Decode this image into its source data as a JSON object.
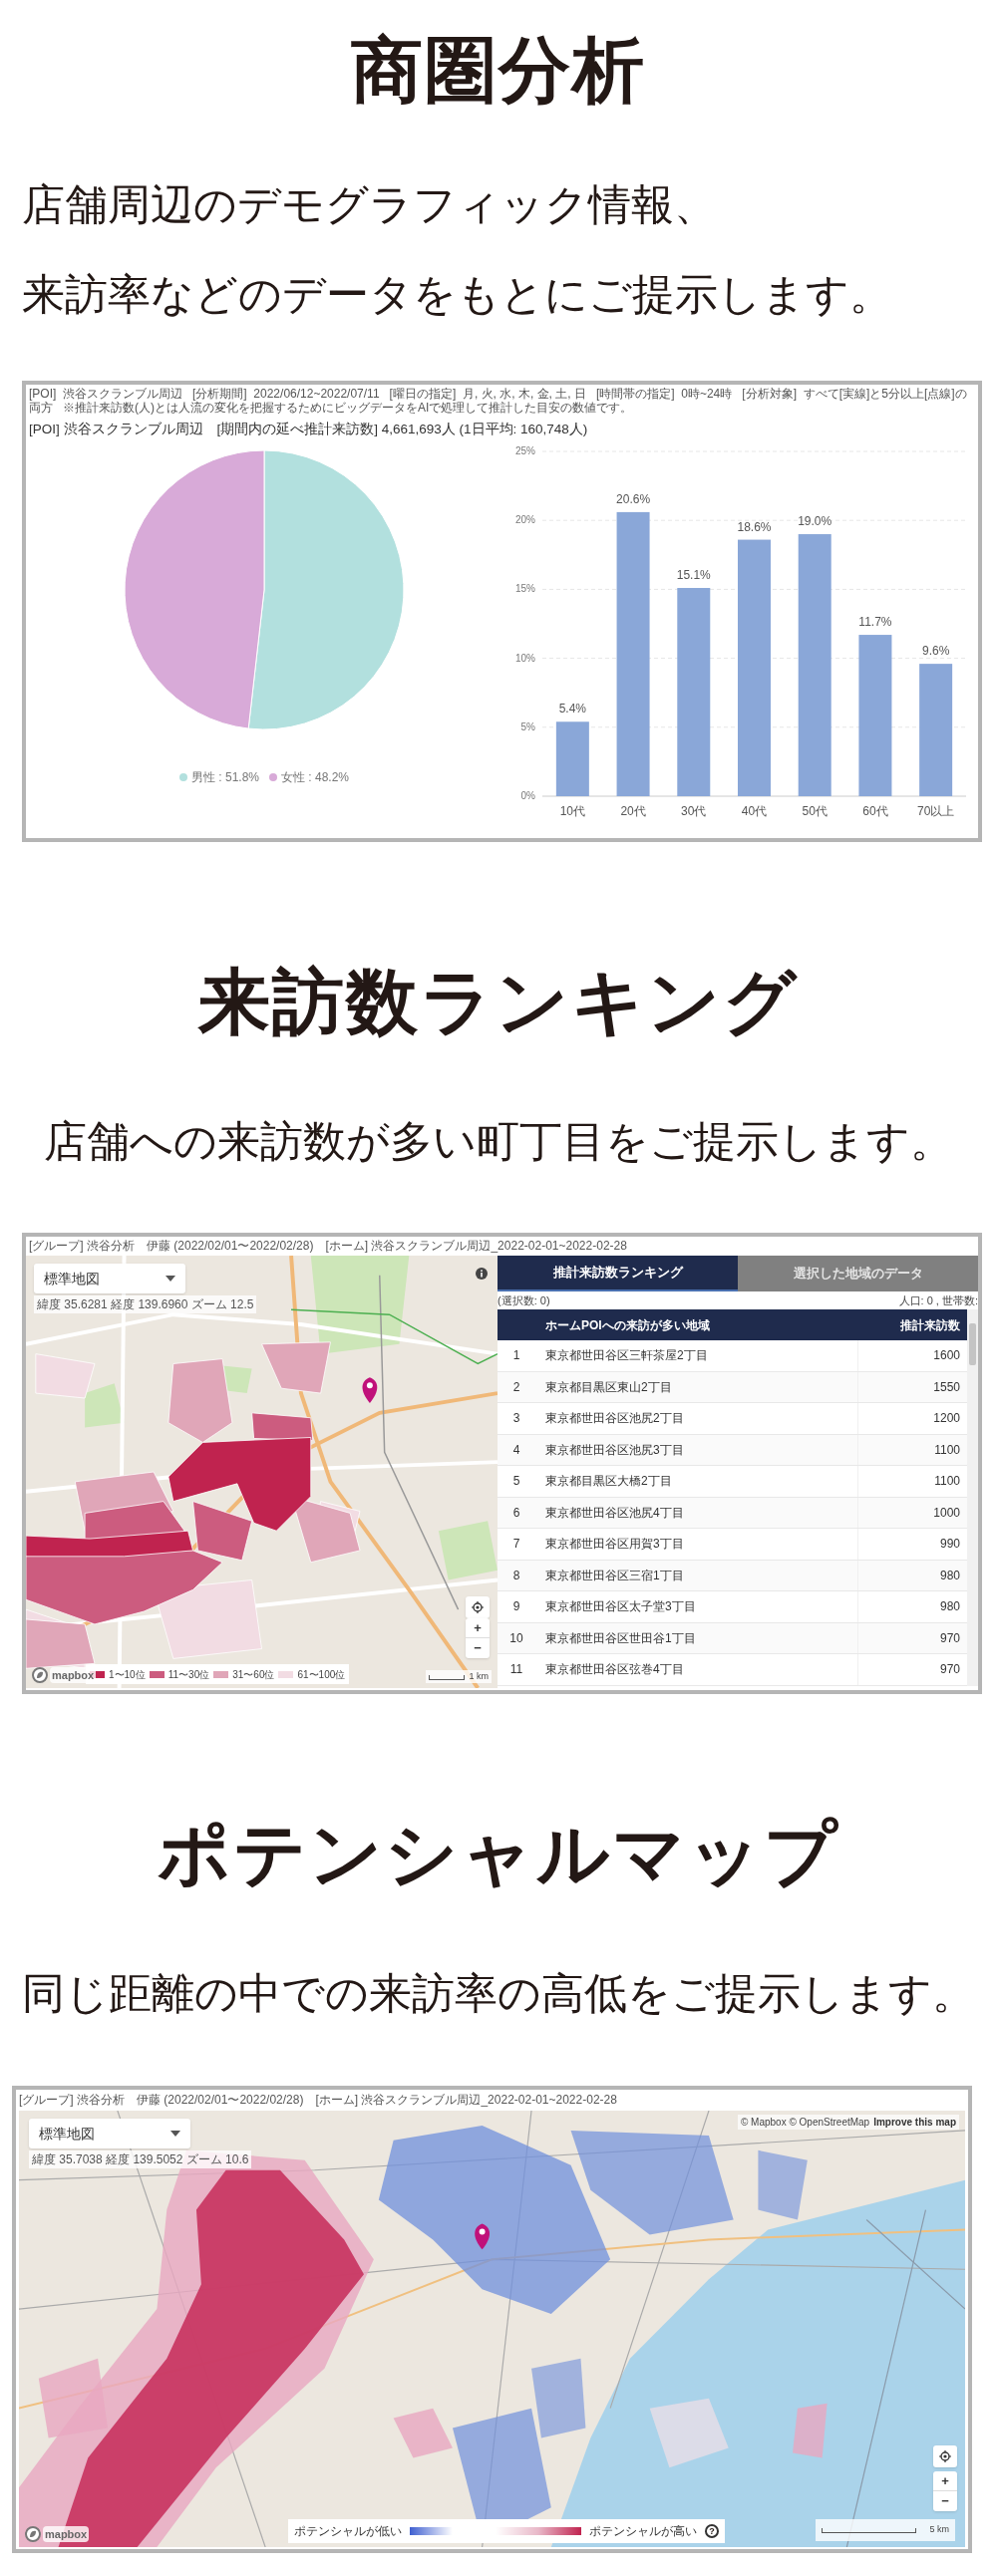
{
  "sections": [
    {
      "kind": "demographics",
      "heading": "商圏分析",
      "lines": [
        "店舗周辺のデモグラフィック情報、",
        "来訪率などのデータをもとにご提示します。"
      ],
      "panel": {
        "conditions": "[POI]  渋谷スクランブル周辺   [分析期間]  2022/06/12~2022/07/11   [曜日の指定]  月, 火, 水, 木, 金, 土, 日   [時間帯の指定]  0時~24時   [分析対象]  すべて[実線]と5分以上[点線]の両方   ※推計来訪数(人)とは人流の変化を把握するためにビッグデータをAIで処理して推計した目安の数値です。",
        "summary": "[POI] 渋谷スクランブル周辺　[期間内の延べ推計来訪数] 4,661,693人 (1日平均: 160,748人)",
        "pie": {
          "chart_data": {
            "type": "pie",
            "values": [
              51.8,
              48.2
            ]
          },
          "legend": [
            {
              "label": "男性 : 51.8%",
              "color": "#b2e0de"
            },
            {
              "label": "女性 : 48.2%",
              "color": "#d8aad8"
            }
          ]
        },
        "bar": {
          "chart_data": {
            "type": "bar",
            "categories": [
              "10代",
              "20代",
              "30代",
              "40代",
              "50代",
              "60代",
              "70以上"
            ],
            "values": [
              5.4,
              20.6,
              15.1,
              18.6,
              19.0,
              11.7,
              9.6
            ],
            "value_labels": [
              "5.4%",
              "20.6%",
              "15.1%",
              "18.6%",
              "19.0%",
              "11.7%",
              "9.6%"
            ],
            "ylim": [
              0,
              25
            ],
            "grid": true,
            "yticks": [
              {
                "value": 0,
                "label": "0%"
              },
              {
                "value": 5,
                "label": "5%"
              },
              {
                "value": 10,
                "label": "10%"
              },
              {
                "value": 15,
                "label": "15%"
              },
              {
                "value": 20,
                "label": "20%"
              },
              {
                "value": 25,
                "label": "25%"
              }
            ]
          }
        }
      }
    },
    {
      "kind": "ranking",
      "heading": "来訪数ランキング",
      "lines": [
        "店舗への来訪数が多い町丁目をご提示します。"
      ],
      "panel": {
        "header": "[グループ] 渋谷分析　伊藤 (2022/02/01〜2022/02/28)　[ホーム] 渋谷スクランブル周辺_2022-02-01~2022-02-28",
        "map": {
          "style_select": "標準地図",
          "coords": "緯度 35.6281 経度 139.6960 ズーム 12.5",
          "zoom_in": "+",
          "zoom_out": "−",
          "scale": "1 km",
          "logo": "mapbox",
          "legend": [
            {
              "label": "1〜10位",
              "color": "#c0234f"
            },
            {
              "label": "11〜30位",
              "color": "#cc5c7f"
            },
            {
              "label": "31〜60位",
              "color": "#e0a6b8"
            },
            {
              "label": "61〜100位",
              "color": "#f2dce3"
            }
          ]
        },
        "tabs": [
          {
            "label": "推計来訪数ランキング",
            "selected": true
          },
          {
            "label": "選択した地域のデータ",
            "selected": false
          }
        ],
        "selection_count": "(選択数: 0)",
        "population": "人口: 0 , 世帯数:",
        "table": {
          "columns": [
            "ホームPOIへの来訪が多い地域",
            "推計来訪数"
          ],
          "rows": [
            {
              "rank": "1",
              "area": "東京都世田谷区三軒茶屋2丁目",
              "visits": "1600"
            },
            {
              "rank": "2",
              "area": "東京都目黒区東山2丁目",
              "visits": "1550"
            },
            {
              "rank": "3",
              "area": "東京都世田谷区池尻2丁目",
              "visits": "1200"
            },
            {
              "rank": "4",
              "area": "東京都世田谷区池尻3丁目",
              "visits": "1100"
            },
            {
              "rank": "5",
              "area": "東京都目黒区大橋2丁目",
              "visits": "1100"
            },
            {
              "rank": "6",
              "area": "東京都世田谷区池尻4丁目",
              "visits": "1000"
            },
            {
              "rank": "7",
              "area": "東京都世田谷区用賀3丁目",
              "visits": "990"
            },
            {
              "rank": "8",
              "area": "東京都世田谷区三宿1丁目",
              "visits": "980"
            },
            {
              "rank": "9",
              "area": "東京都世田谷区太子堂3丁目",
              "visits": "980"
            },
            {
              "rank": "10",
              "area": "東京都世田谷区世田谷1丁目",
              "visits": "970"
            },
            {
              "rank": "11",
              "area": "東京都世田谷区弦巻4丁目",
              "visits": "970"
            }
          ]
        }
      }
    },
    {
      "kind": "potential",
      "heading": "ポテンシャルマップ",
      "lines": [
        "同じ距離の中での来訪率の高低をご提示します。"
      ],
      "panel": {
        "header": "[グループ] 渋谷分析　伊藤 (2022/02/01〜2022/02/28)　[ホーム] 渋谷スクランブル周辺_2022-02-01~2022-02-28",
        "map": {
          "style_select": "標準地図",
          "coords": "緯度 35.7038 経度 139.5052 ズーム 10.6",
          "attribution": "© Mapbox © OpenStreetMap",
          "attribution_link": "Improve this map",
          "zoom_in": "+",
          "zoom_out": "−",
          "scale": "5 km",
          "logo": "mapbox",
          "legend": {
            "low": "ポテンシャルが低い",
            "high": "ポテンシャルが高い",
            "help": "?"
          }
        }
      }
    }
  ]
}
